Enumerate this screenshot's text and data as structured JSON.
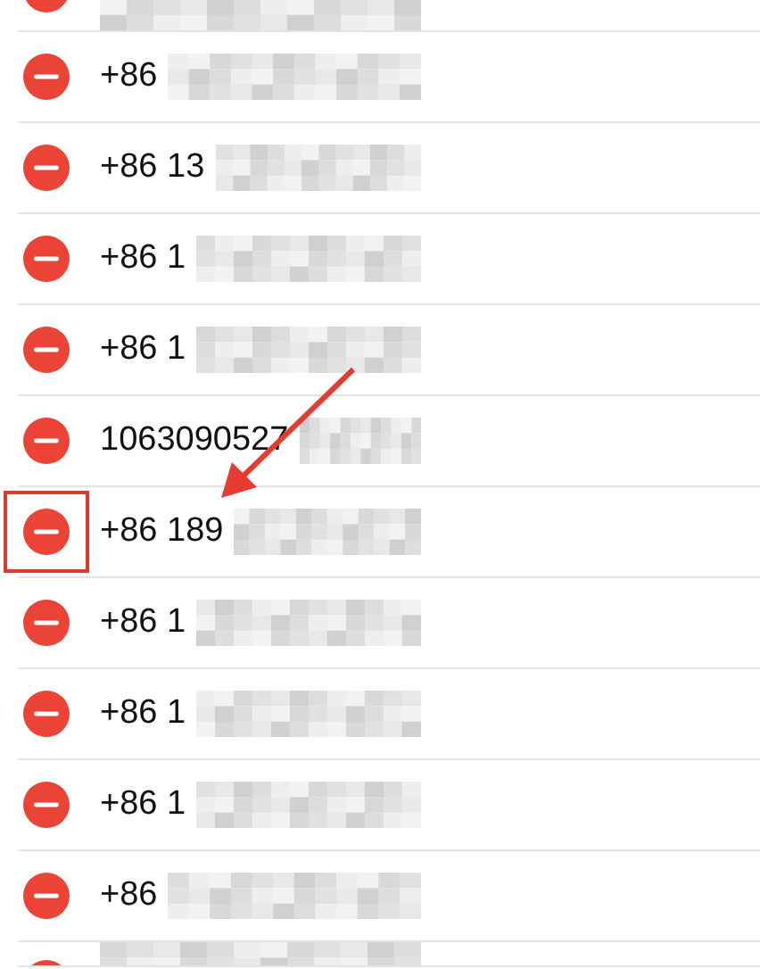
{
  "rows": [
    {
      "number": "",
      "highlighted": false
    },
    {
      "number": "+86",
      "highlighted": false
    },
    {
      "number": "+86 13",
      "highlighted": false
    },
    {
      "number": "+86 1",
      "highlighted": false
    },
    {
      "number": "+86 1",
      "highlighted": false
    },
    {
      "number": "1063090527",
      "highlighted": false
    },
    {
      "number": "+86 189",
      "highlighted": true
    },
    {
      "number": "+86 1",
      "highlighted": false
    },
    {
      "number": "+86 1",
      "highlighted": false
    },
    {
      "number": "+86 1",
      "highlighted": false
    },
    {
      "number": "+86",
      "highlighted": false
    },
    {
      "number": "",
      "highlighted": false
    }
  ]
}
